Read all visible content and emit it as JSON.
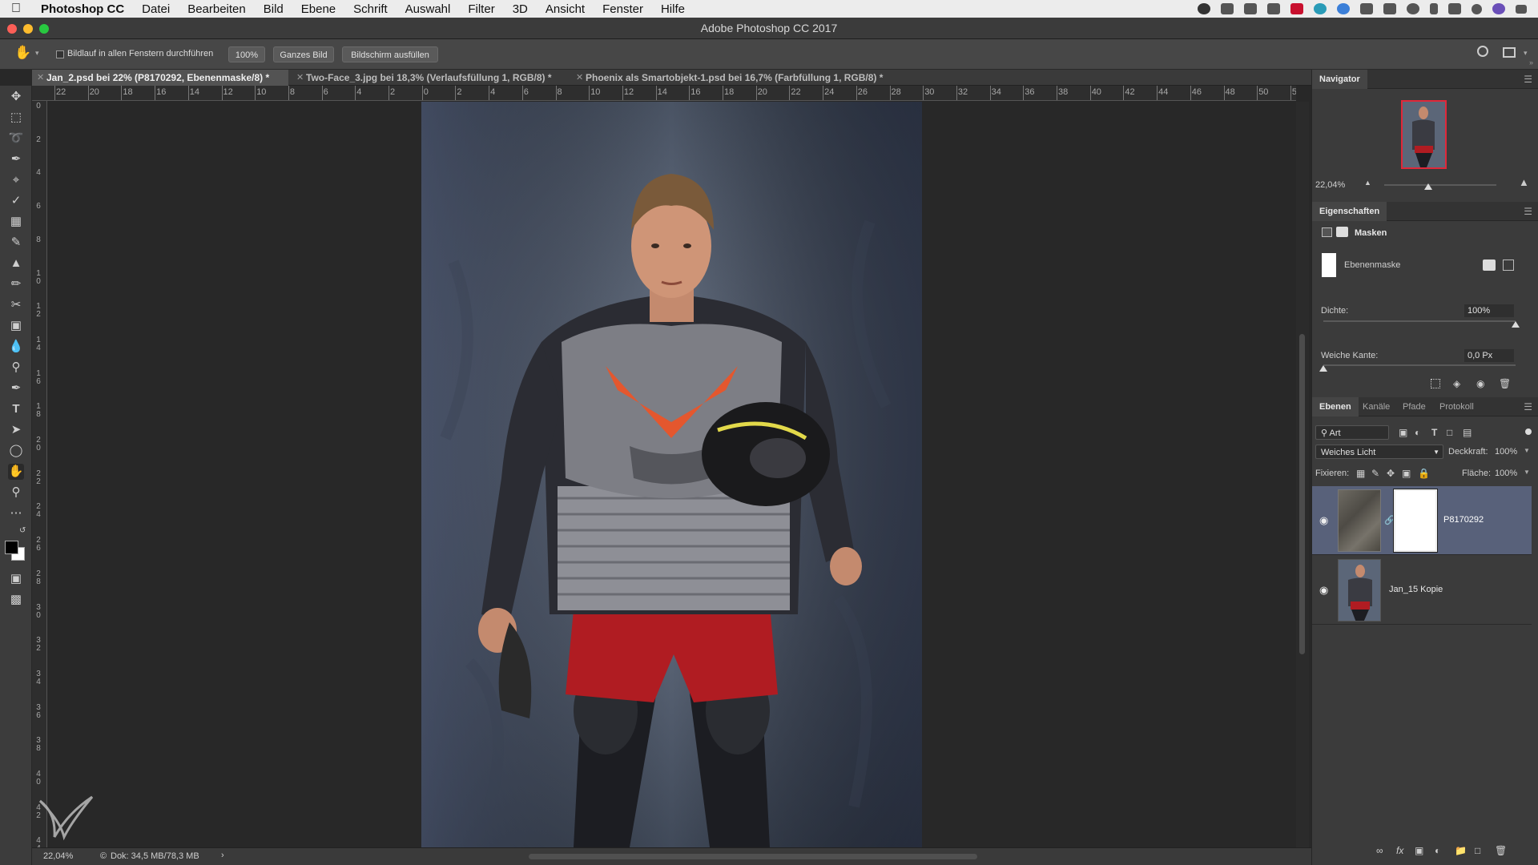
{
  "menubar": {
    "app_name": "Photoshop CC",
    "items": [
      "Datei",
      "Bearbeiten",
      "Bild",
      "Ebene",
      "Schrift",
      "Auswahl",
      "Filter",
      "3D",
      "Ansicht",
      "Fenster",
      "Hilfe"
    ]
  },
  "window": {
    "title": "Adobe Photoshop CC 2017"
  },
  "options_bar": {
    "scroll_all_label": "Bildlauf in allen Fenstern durchführen",
    "zoom_100": "100%",
    "fit_screen": "Ganzes Bild",
    "fill_screen": "Bildschirm ausfüllen"
  },
  "tabs": [
    {
      "label": "Jan_2.psd bei 22% (P8170292, Ebenenmaske/8) *",
      "active": true
    },
    {
      "label": "Two-Face_3.jpg bei 18,3% (Verlaufsfüllung 1, RGB/8) *",
      "active": false
    },
    {
      "label": "Phoenix als Smartobjekt-1.psd bei 16,7% (Farbfüllung 1, RGB/8) *",
      "active": false
    }
  ],
  "ruler_top_ticks": [
    "22",
    "20",
    "18",
    "16",
    "14",
    "12",
    "10",
    "8",
    "6",
    "4",
    "2",
    "0",
    "2",
    "4",
    "6",
    "8",
    "10",
    "12",
    "14",
    "16",
    "18",
    "20",
    "22",
    "24",
    "26",
    "28",
    "30",
    "32",
    "34",
    "36",
    "38",
    "40",
    "42",
    "44",
    "46",
    "48",
    "50",
    "5"
  ],
  "ruler_left_ticks": [
    "0",
    "2",
    "4",
    "6",
    "8",
    "1\n0",
    "1\n2",
    "1\n4",
    "1\n6",
    "1\n8",
    "2\n0",
    "2\n2",
    "2\n4",
    "2\n6",
    "2\n8",
    "3\n0",
    "3\n2",
    "3\n4",
    "3\n6",
    "3\n8",
    "4\n0",
    "4\n2",
    "4\n4"
  ],
  "status_bar": {
    "zoom": "22,04%",
    "doc_info": "Dok: 34,5 MB/78,3 MB"
  },
  "navigator": {
    "title": "Navigator",
    "zoom": "22,04%"
  },
  "properties": {
    "title": "Eigenschaften",
    "section": "Masken",
    "mask_type": "Ebenenmaske",
    "density_label": "Dichte:",
    "density_value": "100%",
    "density_level": 1.0,
    "feather_label": "Weiche Kante:",
    "feather_value": "0,0 Px",
    "feather_level": 0.0
  },
  "layers_panel": {
    "tabs": [
      "Ebenen",
      "Kanäle",
      "Pfade",
      "Protokoll"
    ],
    "filter_label": "Art",
    "blend_mode": "Weiches Licht",
    "opacity_label": "Deckkraft:",
    "opacity_value": "100%",
    "lock_label": "Fixieren:",
    "fill_label": "Fläche:",
    "fill_value": "100%",
    "layers": [
      {
        "name": "P8170292",
        "selected": true
      },
      {
        "name": "Jan_15 Kopie",
        "selected": false
      }
    ]
  },
  "colors": {
    "accent_selected_layer": "#58617a",
    "navigator_frame": "#e0283a"
  }
}
